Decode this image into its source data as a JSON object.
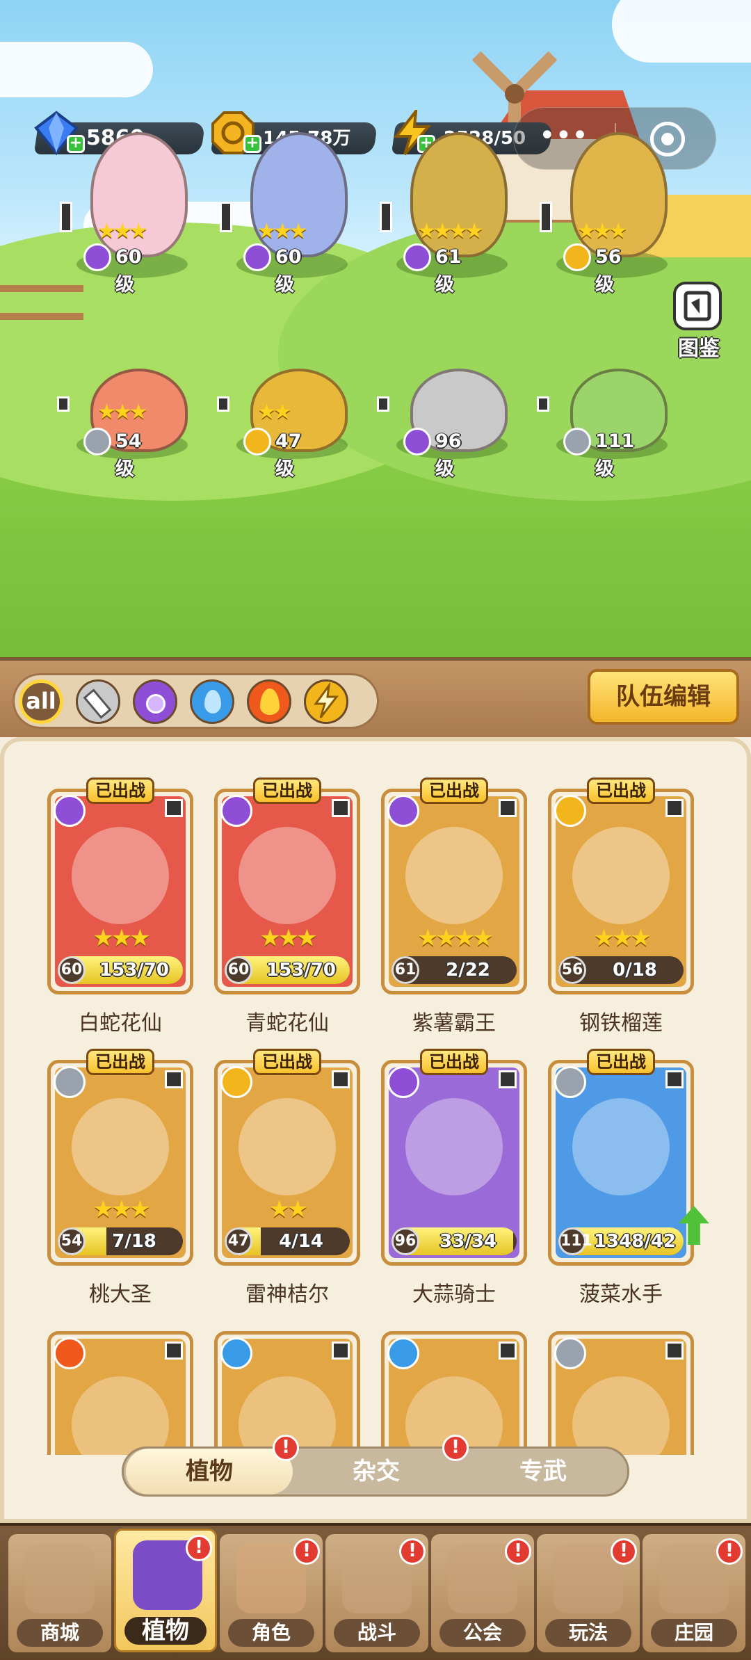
{
  "resources": [
    {
      "name": "diamond",
      "icon": "diamond-icon",
      "value": "5860",
      "color": "#3a7cf2"
    },
    {
      "name": "gold",
      "icon": "gold-coin-icon",
      "value": "145.78万",
      "color": "#f4b320"
    },
    {
      "name": "energy",
      "icon": "lightning-icon",
      "value": "2528/50",
      "color": "#f7c51e"
    }
  ],
  "menu": {
    "more": "more-dots-icon",
    "close": "target-close-icon"
  },
  "codex_label": "图鉴",
  "field_units": [
    {
      "level": "60级",
      "stars": "★★★",
      "element": "poison"
    },
    {
      "level": "60级",
      "stars": "★★★",
      "element": "poison"
    },
    {
      "level": "61级",
      "stars": "★★★★",
      "element": "poison"
    },
    {
      "level": "56级",
      "stars": "★★★",
      "element": "lightning"
    },
    {
      "level": "54级",
      "stars": "★★★",
      "element": "sword"
    },
    {
      "level": "47级",
      "stars": "★★",
      "element": "lightning"
    },
    {
      "level": "96级",
      "stars": "",
      "element": "poison"
    },
    {
      "level": "111级",
      "stars": "",
      "element": "sword"
    }
  ],
  "filters": {
    "all": "all",
    "items": [
      "sword",
      "poison",
      "water",
      "fire",
      "lightning"
    ]
  },
  "team_edit_label": "队伍编辑",
  "deployed_label": "已出战",
  "cards": [
    {
      "name": "白蛇花仙",
      "level": "60",
      "progress": "153/70",
      "fill": 1.0,
      "stars": "★★★",
      "element": "poison",
      "bg": "#e6584a"
    },
    {
      "name": "青蛇花仙",
      "level": "60",
      "progress": "153/70",
      "fill": 1.0,
      "stars": "★★★",
      "element": "poison",
      "bg": "#e6584a"
    },
    {
      "name": "紫薯霸王",
      "level": "61",
      "progress": "2/22",
      "fill": 0.09,
      "stars": "★★★★",
      "element": "poison",
      "bg": "#e3a645"
    },
    {
      "name": "钢铁榴莲",
      "level": "56",
      "progress": "0/18",
      "fill": 0.0,
      "stars": "★★★",
      "element": "lightning",
      "bg": "#e3a645"
    },
    {
      "name": "桃大圣",
      "level": "54",
      "progress": "7/18",
      "fill": 0.39,
      "stars": "★★★",
      "element": "sword",
      "bg": "#e3a645"
    },
    {
      "name": "雷神桔尔",
      "level": "47",
      "progress": "4/14",
      "fill": 0.29,
      "stars": "★★",
      "element": "lightning",
      "bg": "#e3a645"
    },
    {
      "name": "大蒜骑士",
      "level": "96",
      "progress": "33/34",
      "fill": 0.97,
      "stars": "",
      "element": "poison",
      "bg": "#9a6ad8"
    },
    {
      "name": "菠菜水手",
      "level": "111",
      "progress": "1348/42",
      "fill": 1.0,
      "stars": "",
      "element": "sword",
      "bg": "#4f9ae6"
    }
  ],
  "partial_cards": [
    {
      "element": "fire"
    },
    {
      "element": "water"
    },
    {
      "element": "water"
    },
    {
      "element": "sword"
    }
  ],
  "tabs": [
    {
      "label": "植物",
      "active": true
    },
    {
      "label": "杂交",
      "active": false
    },
    {
      "label": "专武",
      "active": false
    }
  ],
  "alert_mark": "!",
  "bottom_nav": [
    {
      "label": "商城",
      "active": false,
      "alert": false
    },
    {
      "label": "植物",
      "active": true,
      "alert": true
    },
    {
      "label": "角色",
      "active": false,
      "alert": true
    },
    {
      "label": "战斗",
      "active": false,
      "alert": true
    },
    {
      "label": "公会",
      "active": false,
      "alert": true
    },
    {
      "label": "玩法",
      "active": false,
      "alert": true
    },
    {
      "label": "庄园",
      "active": false,
      "alert": true
    }
  ],
  "colors": {
    "poison": "#8e4fd6",
    "lightning": "#f3b51c",
    "sword": "#9aa3ad",
    "water": "#3a9be8",
    "fire": "#ef5a1c",
    "alert": "#e23b32"
  }
}
